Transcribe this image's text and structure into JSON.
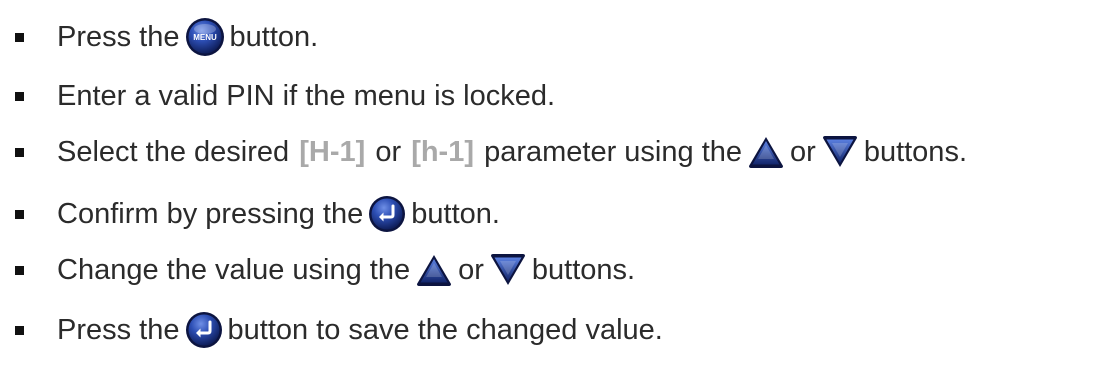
{
  "steps": [
    {
      "before": "Press the",
      "after": "button.",
      "icon": "menu-button-icon",
      "icon_label": "MENU"
    },
    {
      "text": "Enter a valid PIN if the menu is locked."
    },
    {
      "before": "Select the desired",
      "param1": "[H-1]",
      "mid1": "or",
      "param2": "[h-1]",
      "mid2": "parameter using the",
      "or": "or",
      "after": "buttons.",
      "icons": [
        "up-arrow-button-icon",
        "down-arrow-button-icon"
      ]
    },
    {
      "before": "Confirm by pressing the",
      "after": "button.",
      "icon": "enter-button-icon"
    },
    {
      "before": "Change the value using the",
      "or": "or",
      "after": "buttons.",
      "icons": [
        "up-arrow-button-icon",
        "down-arrow-button-icon"
      ]
    },
    {
      "before": "Press the",
      "after": "button to save the changed value.",
      "icon": "enter-button-icon"
    }
  ],
  "colors": {
    "text": "#2b2b2b",
    "param": "#a9a9a9",
    "button_blue": "#1f3f8f"
  }
}
